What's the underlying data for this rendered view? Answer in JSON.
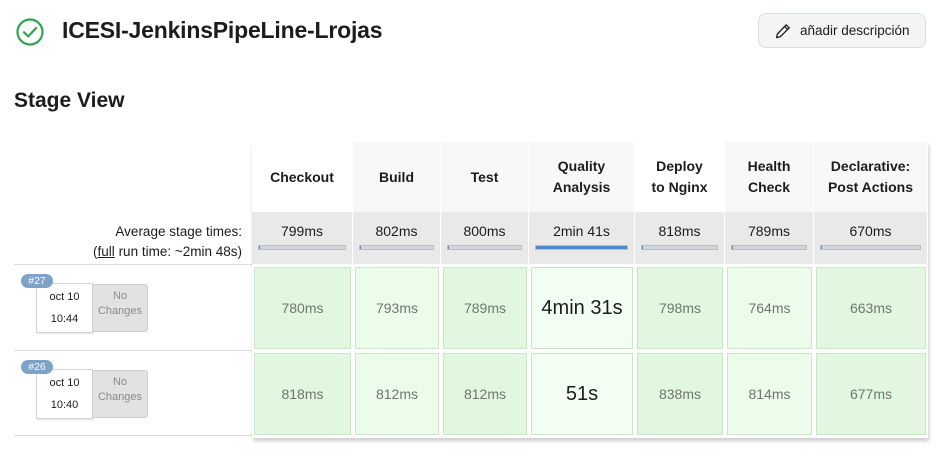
{
  "header": {
    "title": "ICESI-JenkinsPipeLine-Lrojas",
    "add_description_label": "añadir descripción",
    "status_color": "#2fa34d"
  },
  "stage_view": {
    "title": "Stage View",
    "average_label": "Average stage times:",
    "full_run_prefix": "(",
    "full_run_link": "full",
    "full_run_suffix": " run time: ~2min 48s)"
  },
  "stages": [
    {
      "name_line1": "Checkout",
      "name_line2": "",
      "average": "799ms",
      "average_fraction": 0.005
    },
    {
      "name_line1": "Build",
      "name_line2": "",
      "average": "802ms",
      "average_fraction": 0.005
    },
    {
      "name_line1": "Test",
      "name_line2": "",
      "average": "800ms",
      "average_fraction": 0.005
    },
    {
      "name_line1": "Quality",
      "name_line2": "Analysis",
      "average": "2min 41s",
      "average_fraction": 1.0
    },
    {
      "name_line1": "Deploy",
      "name_line2": "to Nginx",
      "average": "818ms",
      "average_fraction": 0.005
    },
    {
      "name_line1": "Health",
      "name_line2": "Check",
      "average": "789ms",
      "average_fraction": 0.005
    },
    {
      "name_line1": "Declarative:",
      "name_line2": "Post Actions",
      "average": "670ms",
      "average_fraction": 0.004
    }
  ],
  "builds": [
    {
      "number": "#27",
      "date": "oct 10",
      "time": "10:44",
      "changes_line1": "No",
      "changes_line2": "Changes",
      "durations": [
        "780ms",
        "793ms",
        "789ms",
        "4min 31s",
        "798ms",
        "764ms",
        "663ms"
      ]
    },
    {
      "number": "#26",
      "date": "oct 10",
      "time": "10:40",
      "changes_line1": "No",
      "changes_line2": "Changes",
      "durations": [
        "818ms",
        "812ms",
        "812ms",
        "51s",
        "838ms",
        "814ms",
        "677ms"
      ]
    }
  ],
  "icons": {
    "status": "check-circle-icon",
    "edit": "pencil-icon"
  }
}
